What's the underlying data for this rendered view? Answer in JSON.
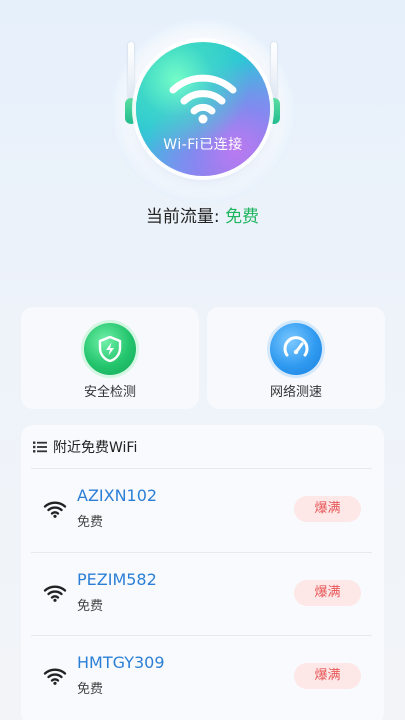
{
  "hero": {
    "status_text": "Wi-Fi已连接",
    "traffic_label": "当前流量: ",
    "traffic_value": "免费",
    "icon": "wifi-icon",
    "accent_green": "#1fb55f"
  },
  "features": [
    {
      "label": "安全检测",
      "icon": "shield-lightning-icon",
      "color": "#23c46c"
    },
    {
      "label": "网络测速",
      "icon": "speedometer-icon",
      "color": "#2f9af0"
    }
  ],
  "nearby": {
    "title": "附近免费WiFi",
    "title_icon": "list-icon",
    "networks": [
      {
        "ssid": "AZIXN102",
        "price": "免费",
        "badge": "爆满",
        "icon": "wifi-icon"
      },
      {
        "ssid": "PEZIM582",
        "price": "免费",
        "badge": "爆满",
        "icon": "wifi-icon"
      },
      {
        "ssid": "HMTGY309",
        "price": "免费",
        "badge": "爆满",
        "icon": "wifi-icon"
      }
    ]
  }
}
